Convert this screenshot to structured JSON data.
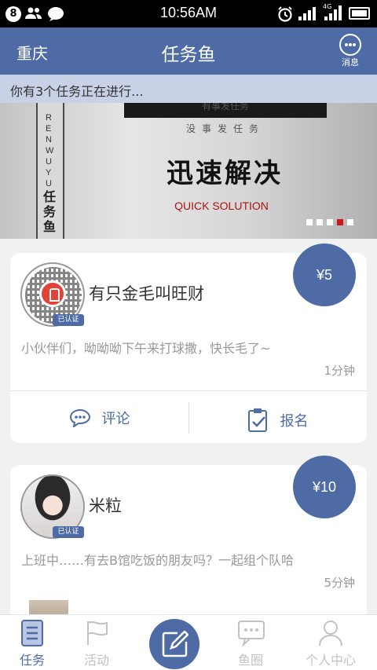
{
  "status_bar": {
    "badge": "8",
    "time": "10:56AM",
    "network": "4G"
  },
  "header": {
    "city": "重庆",
    "title": "任务鱼",
    "message_label": "消息"
  },
  "notice": "你有3个任务正在进行...",
  "banner": {
    "top_text": "有事发任务",
    "sub_text": "没事发任务",
    "brand_en": "RENWUYU",
    "brand_cn": "任务鱼",
    "main_text": "迅速解决",
    "en_text": "QUICK SOLUTION",
    "slide_count": 5,
    "active_slide": 4
  },
  "tasks": [
    {
      "username": "有只金毛叫旺财",
      "verified": "已认证",
      "price": "¥5",
      "description": "小伙伴们，呦呦呦下午来打球撒，快长毛了~",
      "time": "1分钟",
      "comment_label": "评论",
      "signup_label": "报名"
    },
    {
      "username": "米粒",
      "verified": "已认证",
      "price": "¥10",
      "description": "上班中……有去B馆吃饭的朋友吗？一起组个队哈",
      "time": "5分钟"
    }
  ],
  "tabbar": {
    "tasks": "任务",
    "activities": "活动",
    "fish_circle": "鱼圈",
    "profile": "个人中心"
  },
  "colors": {
    "primary": "#4e6ba6",
    "notice_bg": "#c8d1e6",
    "accent_red": "#d41414"
  }
}
